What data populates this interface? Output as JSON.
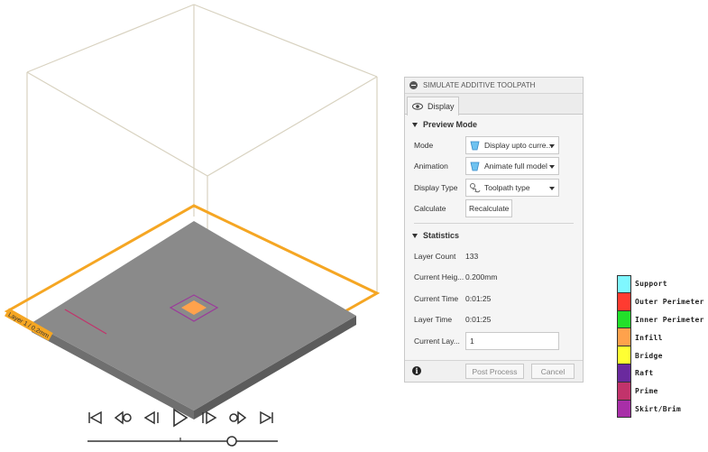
{
  "viewport": {
    "layer_tag": "Layer 1 / 0.2mm"
  },
  "controls": {
    "icons": [
      "skip-start-icon",
      "step-back-keyframe-icon",
      "step-back-icon",
      "play-icon",
      "step-forward-icon",
      "step-forward-keyframe-icon",
      "skip-end-icon"
    ]
  },
  "panel": {
    "title": "SIMULATE ADDITIVE TOOLPATH",
    "tab": "Display",
    "preview_section": "Preview Mode",
    "rows": {
      "mode_label": "Mode",
      "mode_value": "Display upto curre...",
      "animation_label": "Animation",
      "animation_value": "Animate full model",
      "display_type_label": "Display Type",
      "display_type_value": "Toolpath type",
      "calculate_label": "Calculate",
      "recalculate_button": "Recalculate"
    },
    "statistics_section": "Statistics",
    "stats": {
      "layer_count_label": "Layer Count",
      "layer_count_value": "133",
      "current_height_label": "Current Heig...",
      "current_height_value": "0.200mm",
      "current_time_label": "Current Time",
      "current_time_value": "0:01:25",
      "layer_time_label": "Layer Time",
      "layer_time_value": "0:01:25",
      "current_layer_label": "Current Lay...",
      "current_layer_value": "1"
    },
    "footer": {
      "post_process": "Post Process",
      "cancel": "Cancel"
    }
  },
  "legend": [
    {
      "label": "Support",
      "color": "#7ff7ff"
    },
    {
      "label": "Outer Perimeter",
      "color": "#ff3b30"
    },
    {
      "label": "Inner Perimeter",
      "color": "#22e02a"
    },
    {
      "label": "Infill",
      "color": "#ffa24c"
    },
    {
      "label": "Bridge",
      "color": "#ffff33"
    },
    {
      "label": "Raft",
      "color": "#6a2a9e"
    },
    {
      "label": "Prime",
      "color": "#c2336b"
    },
    {
      "label": "Skirt/Brim",
      "color": "#a82fa8"
    }
  ],
  "colors": {
    "build_volume_edge": "#d8d2c0",
    "bed_outline": "#f5a623",
    "plate_top": "#8a8a8a",
    "infill_patch": "#ffa24c",
    "skirt": "#9b3a9b"
  }
}
